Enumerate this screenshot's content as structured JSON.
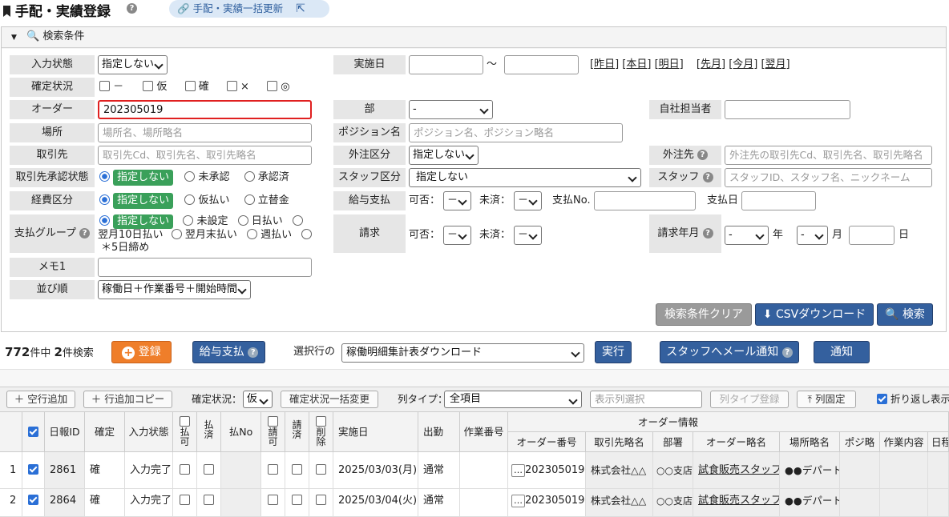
{
  "title": {
    "text": "手配・実績登録",
    "bulk_link": "手配・実績一括更新"
  },
  "search": {
    "header": "検索条件",
    "input_status": {
      "label": "入力状態",
      "value": "指定しない"
    },
    "confirm_status": {
      "label": "確定状況",
      "options": [
        "－",
        "仮",
        "確",
        "×",
        "◎"
      ]
    },
    "order": {
      "label": "オーダー",
      "value": "202305019"
    },
    "place": {
      "label": "場所",
      "placeholder": "場所名、場所略名"
    },
    "client": {
      "label": "取引先",
      "placeholder": "取引先Cd、取引先名、取引先略名"
    },
    "client_approval": {
      "label": "取引先承認状態",
      "options": [
        "指定しない",
        "未承認",
        "承認済"
      ]
    },
    "expense": {
      "label": "経費区分",
      "options": [
        "指定しない",
        "仮払い",
        "立替金"
      ]
    },
    "pay_group": {
      "label": "支払グループ",
      "options": [
        "指定しない",
        "未設定",
        "日払い",
        "翌月10日払い",
        "翌月末払い",
        "週払い",
        "＊5日締め"
      ]
    },
    "memo": {
      "label": "メモ1"
    },
    "sort": {
      "label": "並び順",
      "value": "稼働日＋作業番号＋開始時間"
    },
    "date": {
      "label": "実施日",
      "tilde": "～",
      "links": [
        "[昨日]",
        "[本日]",
        "[明日]",
        "[先月]",
        "[今月]",
        "[翌月]"
      ]
    },
    "dept": {
      "label": "部",
      "value": "-"
    },
    "position": {
      "label": "ポジション名",
      "placeholder": "ポジション名、ポジション略名"
    },
    "outsource_type": {
      "label": "外注区分",
      "value": "指定しない"
    },
    "staff_type": {
      "label": "スタッフ区分",
      "value": "指定しない"
    },
    "salary": {
      "label": "給与支払",
      "ok": "可否：",
      "unpaid": "未済：",
      "ok_value": "－",
      "unpaid_value": "－",
      "pay_no": "支払No.",
      "pay_date": "支払日"
    },
    "billing": {
      "label": "請求",
      "ok": "可否：",
      "unpaid": "未済：",
      "ok_value": "－",
      "unpaid_value": "－"
    },
    "own_staff": {
      "label": "自社担当者"
    },
    "outsource": {
      "label": "外注先",
      "placeholder": "外注先の取引先Cd、取引先名、取引先略名"
    },
    "staff": {
      "label": "スタッフ",
      "placeholder": "スタッフID、スタッフ名、ニックネーム"
    },
    "bill_month": {
      "label": "請求年月",
      "year_value": "-",
      "month_value": "-",
      "year": "年",
      "month": "月",
      "day": "日"
    },
    "clear_btn": "検索条件クリア",
    "csv_btn": "CSVダウンロード",
    "search_btn": "検索"
  },
  "actions": {
    "count_total": "772",
    "count_mid": "件中",
    "count_found": "2",
    "count_suffix": "件検索",
    "register": "登録",
    "salary_pay": "給与支払",
    "selected_rows": "選択行の",
    "action_value": "稼働明細集計表ダウンロード",
    "execute": "実行",
    "mail": "スタッフへメール通知",
    "notify": "通知"
  },
  "toolbar": {
    "add_row": "＋ 空行追加",
    "copy_row": "＋ 行追加コピー",
    "confirm_label": "確定状況：",
    "confirm_value": "仮",
    "bulk_change": "確定状況一括変更",
    "col_type_label": "列タイプ：",
    "col_type_value": "全項目",
    "display_cols": "表示列選択",
    "col_type_register": "列タイプ登録",
    "fix_cols": "列固定",
    "wrap": "折り返し表示"
  },
  "grid": {
    "headers": {
      "report_id": "日報ID",
      "confirm": "確定",
      "input_status": "入力状態",
      "pay_ok": "払可",
      "pay_done": "払済",
      "pay_no": "払No",
      "bill_ok": "請可",
      "bill_done": "請済",
      "delete": "削除",
      "date": "実施日",
      "attend": "出勤",
      "work_no": "作業番号",
      "order_group": "オーダー情報",
      "order_no": "オーダー番号",
      "client_short": "取引先略名",
      "dept": "部署",
      "order_short": "オーダー略名",
      "place_short": "場所略名",
      "pos_short": "ポジ略",
      "work_content": "作業内容",
      "work_date": "日程"
    },
    "rows": [
      {
        "n": "1",
        "id": "2861",
        "confirm": "確",
        "status": "入力完了",
        "date": "2025/03/03(月)",
        "attend": "通常",
        "order_no": "202305019",
        "client": "株式会社△△",
        "dept": "○○支店",
        "order": "試食販売スタッフ",
        "place": "●●デパート"
      },
      {
        "n": "2",
        "id": "2864",
        "confirm": "確",
        "status": "入力完了",
        "date": "2025/03/04(火)",
        "attend": "通常",
        "order_no": "202305019",
        "client": "株式会社△△",
        "dept": "○○支店",
        "order": "試食販売スタッフ",
        "place": "●●デパート"
      }
    ]
  }
}
